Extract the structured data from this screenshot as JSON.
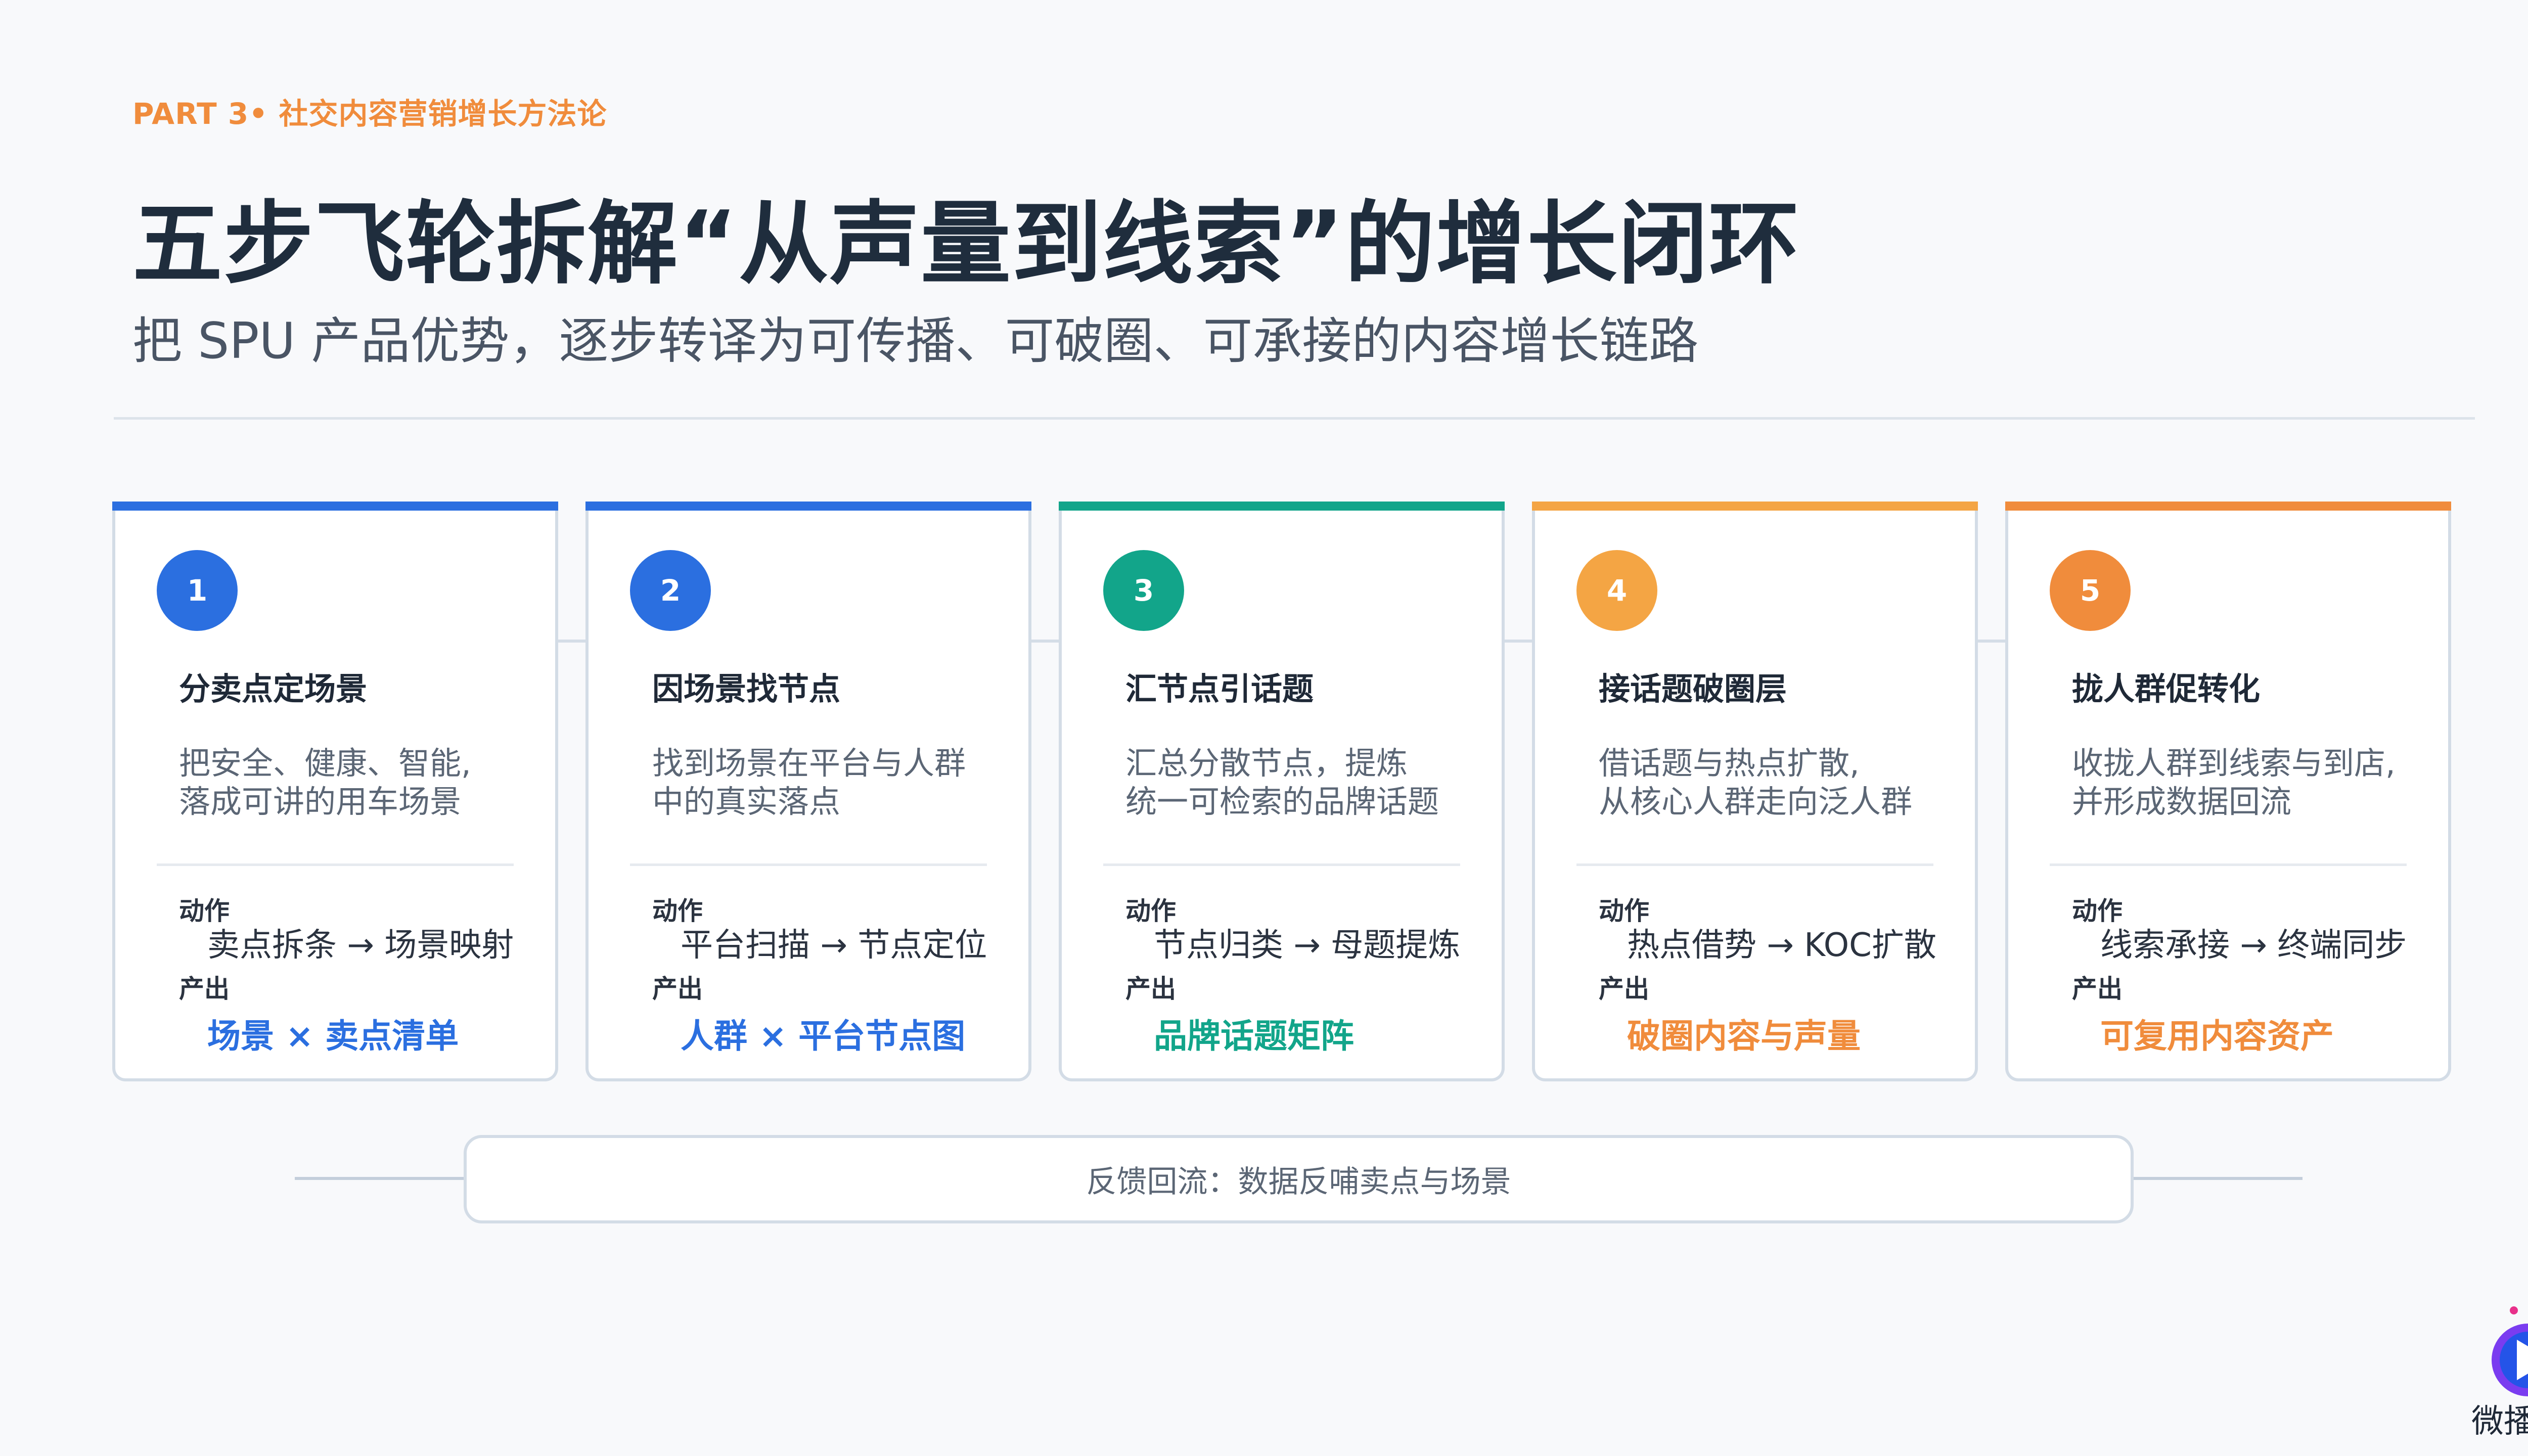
{
  "header": {
    "kicker": "PART 3• 社交内容营销增长方法论",
    "title": "五步飞轮拆解“从声量到线索”的增长闭环",
    "subtitle": "把 SPU 产品优势，逐步转译为可传播、可破圈、可承接的内容增长链路"
  },
  "labels": {
    "action": "动作",
    "output": "产出"
  },
  "steps": [
    {
      "number": "1",
      "title": "分卖点定场景",
      "desc": "把安全、健康、智能,\n落成可讲的用车场景",
      "action": "卖点拆条 → 场景映射",
      "output": "场景 × 卖点清单",
      "color": "#2b6fe0"
    },
    {
      "number": "2",
      "title": "因场景找节点",
      "desc": "找到场景在平台与人群\n中的真实落点",
      "action": "平台扫描 → 节点定位",
      "output": "人群 × 平台节点图",
      "color": "#2b6fe0"
    },
    {
      "number": "3",
      "title": "汇节点引话题",
      "desc": "汇总分散节点，提炼\n统一可检索的品牌话题",
      "action": "节点归类 → 母题提炼",
      "output": "品牌话题矩阵",
      "color": "#12a58a"
    },
    {
      "number": "4",
      "title": "接话题破圈层",
      "desc": "借话题与热点扩散,\n从核心人群走向泛人群",
      "action": "热点借势 → KOC扩散",
      "output": "破圈内容与声量",
      "color": "#f4a544"
    },
    {
      "number": "5",
      "title": "拢人群促转化",
      "desc": "收拢人群到线索与到店,\n并形成数据回流",
      "action": "线索承接 → 终端同步",
      "output": "可复用内容资产",
      "color": "#f08c3c"
    }
  ],
  "feedback": "反馈回流：数据反哺卖点与场景",
  "brand": {
    "name": "微播易",
    "icon": "play-logo-icon"
  }
}
